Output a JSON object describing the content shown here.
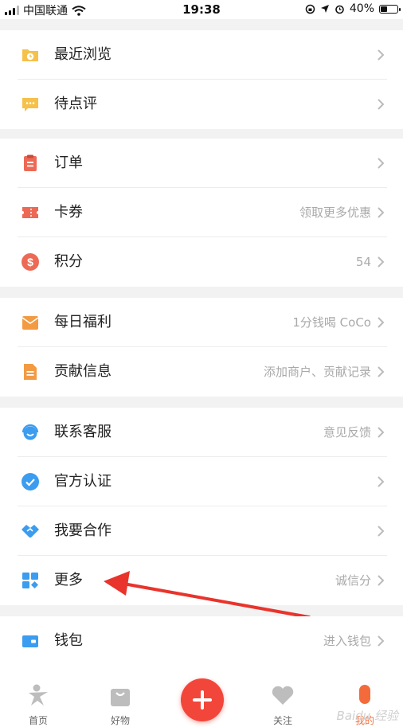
{
  "status_bar": {
    "carrier": "中国联通",
    "time": "19:38",
    "battery_percent": "40%",
    "battery_level": 0.4
  },
  "groups": [
    {
      "items": [
        {
          "label": "最近浏览",
          "hint": "",
          "icon": "folder-clock-icon"
        },
        {
          "label": "待点评",
          "hint": "",
          "icon": "comment-bubble-icon"
        }
      ]
    },
    {
      "items": [
        {
          "label": "订单",
          "hint": "",
          "icon": "clipboard-icon"
        },
        {
          "label": "卡券",
          "hint": "领取更多优惠",
          "icon": "ticket-icon"
        },
        {
          "label": "积分",
          "hint": "54",
          "icon": "dollar-coin-icon"
        }
      ]
    },
    {
      "items": [
        {
          "label": "每日福利",
          "hint": "1分钱喝 CoCo",
          "icon": "envelope-icon"
        },
        {
          "label": "贡献信息",
          "hint": "添加商户、贡献记录",
          "icon": "document-icon"
        }
      ]
    },
    {
      "items": [
        {
          "label": "联系客服",
          "hint": "意见反馈",
          "icon": "headset-icon"
        },
        {
          "label": "官方认证",
          "hint": "",
          "icon": "verified-check-icon"
        },
        {
          "label": "我要合作",
          "hint": "",
          "icon": "handshake-icon"
        },
        {
          "label": "更多",
          "hint": "诚信分",
          "icon": "grid-icon"
        }
      ]
    },
    {
      "items": [
        {
          "label": "钱包",
          "hint": "进入钱包",
          "icon": "wallet-icon"
        }
      ]
    }
  ],
  "tabbar": {
    "tabs": [
      {
        "label": "首页",
        "icon": "home-figure-icon"
      },
      {
        "label": "好物",
        "icon": "shopping-bag-icon"
      },
      {
        "label": "关注",
        "icon": "heart-icon"
      },
      {
        "label": "我的",
        "icon": "profile-icon"
      }
    ],
    "active": "我的"
  },
  "watermark": "Baidu 经验"
}
